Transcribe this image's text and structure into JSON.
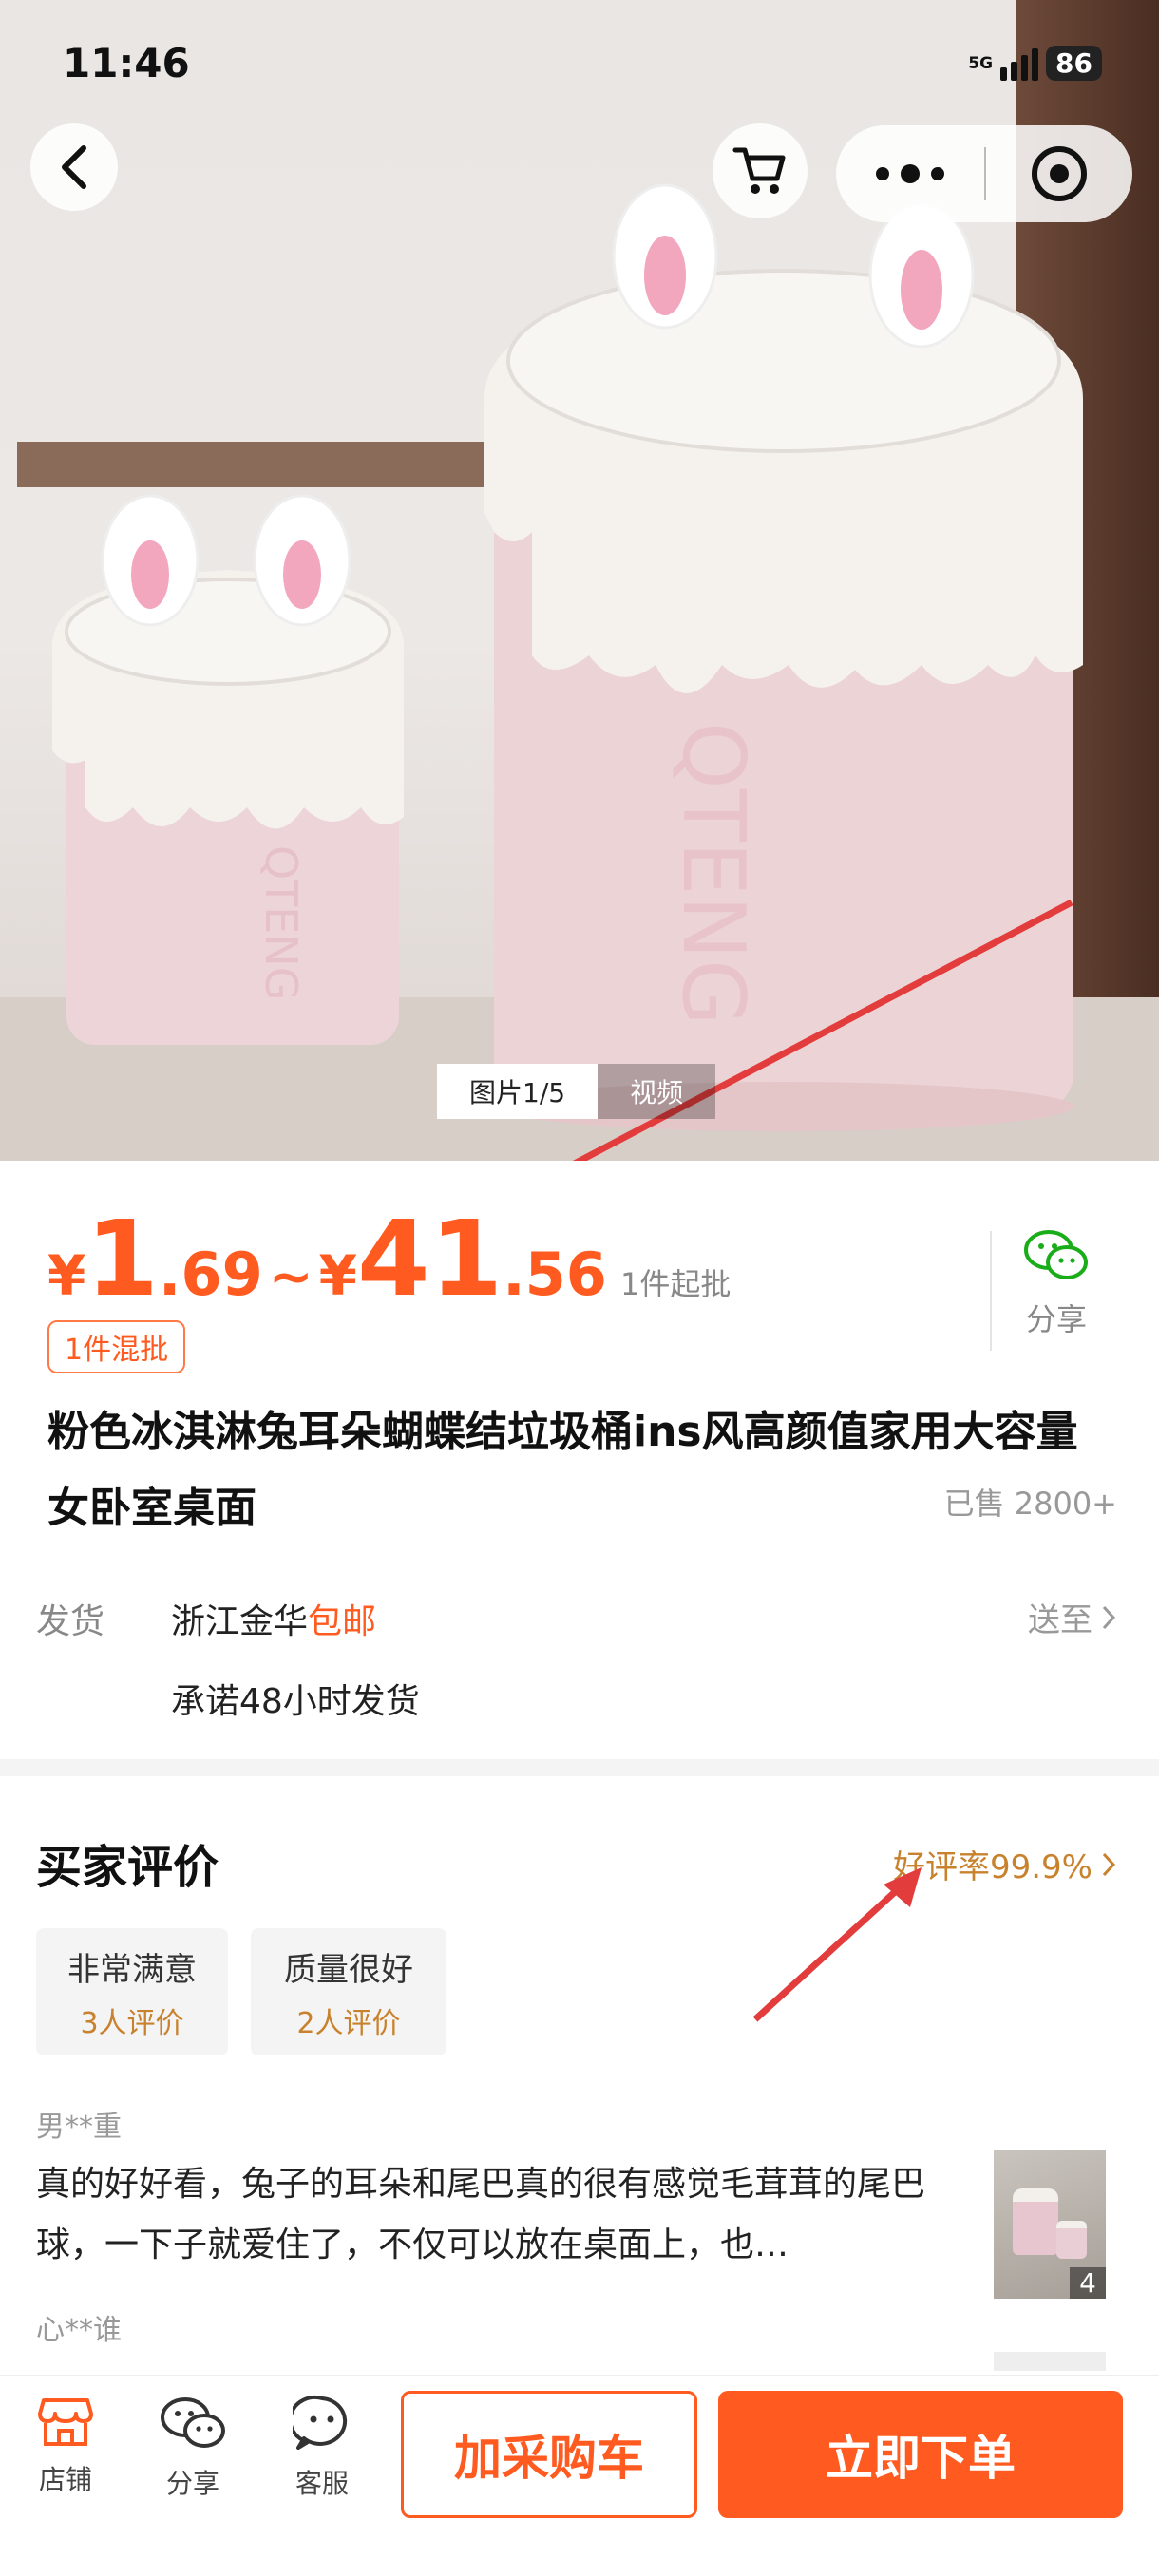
{
  "status_bar": {
    "time": "11:46",
    "network": "5G",
    "battery": "86"
  },
  "nav": {
    "back_icon": "chevron-left-icon",
    "cart_icon": "cart-icon",
    "more_icon": "more-dots-icon",
    "close_icon": "target-circle-icon"
  },
  "gallery": {
    "tabs": [
      {
        "label": "图片1/5",
        "active": true
      },
      {
        "label": "视频",
        "active": false
      }
    ]
  },
  "price": {
    "low_yen": "¥",
    "low_int": "1",
    "low_dec": ".69",
    "separator": "~",
    "high_yen": "¥",
    "high_int": "41",
    "high_dec": ".56",
    "min_order": "1件起批",
    "color": "#ff5a1f"
  },
  "share": {
    "label": "分享",
    "icon": "wechat-icon"
  },
  "badge": {
    "label": "1件混批"
  },
  "product": {
    "title": "粉色冰淇淋兔耳朵蝴蝶结垃圾桶ins风高颜值家用大容量女卧室桌面",
    "sold": "已售 2800+"
  },
  "shipping": {
    "label": "发货",
    "origin": "浙江金华",
    "free_shipping": "包邮",
    "ship_to": "送至",
    "promise": "承诺48小时发货"
  },
  "reviews": {
    "title": "买家评价",
    "rating": "好评率99.9%",
    "accent": "#c8822e",
    "tags": [
      {
        "label": "非常满意",
        "count": "3人评价"
      },
      {
        "label": "质量很好",
        "count": "2人评价"
      }
    ],
    "items": [
      {
        "user": "男**重",
        "text": "真的好好看，兔子的耳朵和尾巴真的很有感觉毛茸茸的尾巴球，一下子就爱住了，不仅可以放在桌面上，也…",
        "image_count": "4"
      },
      {
        "user": "心**谁"
      }
    ]
  },
  "bottom_bar": {
    "items": [
      {
        "label": "店铺",
        "icon": "store-icon"
      },
      {
        "label": "分享",
        "icon": "wechat-icon"
      },
      {
        "label": "客服",
        "icon": "customer-service-icon"
      }
    ],
    "add_cart": "加采购车",
    "buy_now": "立即下单"
  }
}
